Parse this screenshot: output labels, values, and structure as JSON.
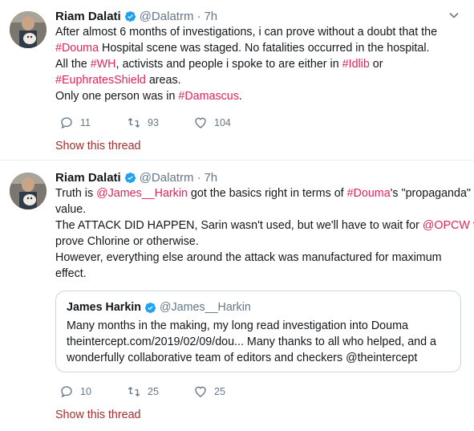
{
  "colors": {
    "hashtag": "#e0245e",
    "muted": "#657786",
    "verified": "#1da1f2",
    "show_thread": "#a02f2f",
    "border": "#e6ecf0"
  },
  "tweets": [
    {
      "author_name": "Riam Dalati",
      "handle": "@Dalatrm",
      "separator": "·",
      "time": "7h",
      "lines": [
        [
          {
            "t": "After almost 6 months of investigations, i can prove without a doubt that the"
          }
        ],
        [
          {
            "t": "#Douma",
            "tag": true
          },
          {
            "t": " Hospital scene was staged. No fatalities occurred in the hospital."
          }
        ],
        [
          {
            "t": "All the "
          },
          {
            "t": "#WH",
            "tag": true
          },
          {
            "t": ", activists and people i spoke to are either in "
          },
          {
            "t": "#Idlib",
            "tag": true
          },
          {
            "t": " or"
          }
        ],
        [
          {
            "t": "#EuphratesShield",
            "tag": true
          },
          {
            "t": " areas."
          }
        ],
        [
          {
            "t": "Only one person was in "
          },
          {
            "t": "#Damascus",
            "tag": true
          },
          {
            "t": "."
          }
        ]
      ],
      "reply_count": "11",
      "retweet_count": "93",
      "like_count": "104",
      "show_thread": "Show this thread"
    },
    {
      "author_name": "Riam Dalati",
      "handle": "@Dalatrm",
      "separator": "·",
      "time": "7h",
      "lines": [
        [
          {
            "t": "Truth is "
          },
          {
            "t": "@James__Harkin",
            "tag": true
          },
          {
            "t": " got the basics right in terms of "
          },
          {
            "t": "#Douma",
            "tag": true
          },
          {
            "t": "'s \"propaganda\""
          }
        ],
        [
          {
            "t": "value."
          }
        ],
        [
          {
            "t": "The ATTACK DID HAPPEN, Sarin wasn't used, but we'll have to wait for "
          },
          {
            "t": "@OPCW",
            "tag": true
          },
          {
            "t": " to"
          }
        ],
        [
          {
            "t": "prove Chlorine or otherwise."
          }
        ],
        [
          {
            "t": "However, everything else around the attack was manufactured for maximum"
          }
        ],
        [
          {
            "t": "effect."
          }
        ]
      ],
      "quote": {
        "author_name": "James Harkin",
        "handle": "@James__Harkin",
        "lines": [
          "Many months in the making, my long read investigation into Douma",
          "theintercept.com/2019/02/09/dou... Many thanks to all who helped, and a",
          "wonderfully collaborative team of editors and checkers @theintercept"
        ]
      },
      "reply_count": "10",
      "retweet_count": "25",
      "like_count": "25",
      "show_thread": "Show this thread"
    }
  ]
}
